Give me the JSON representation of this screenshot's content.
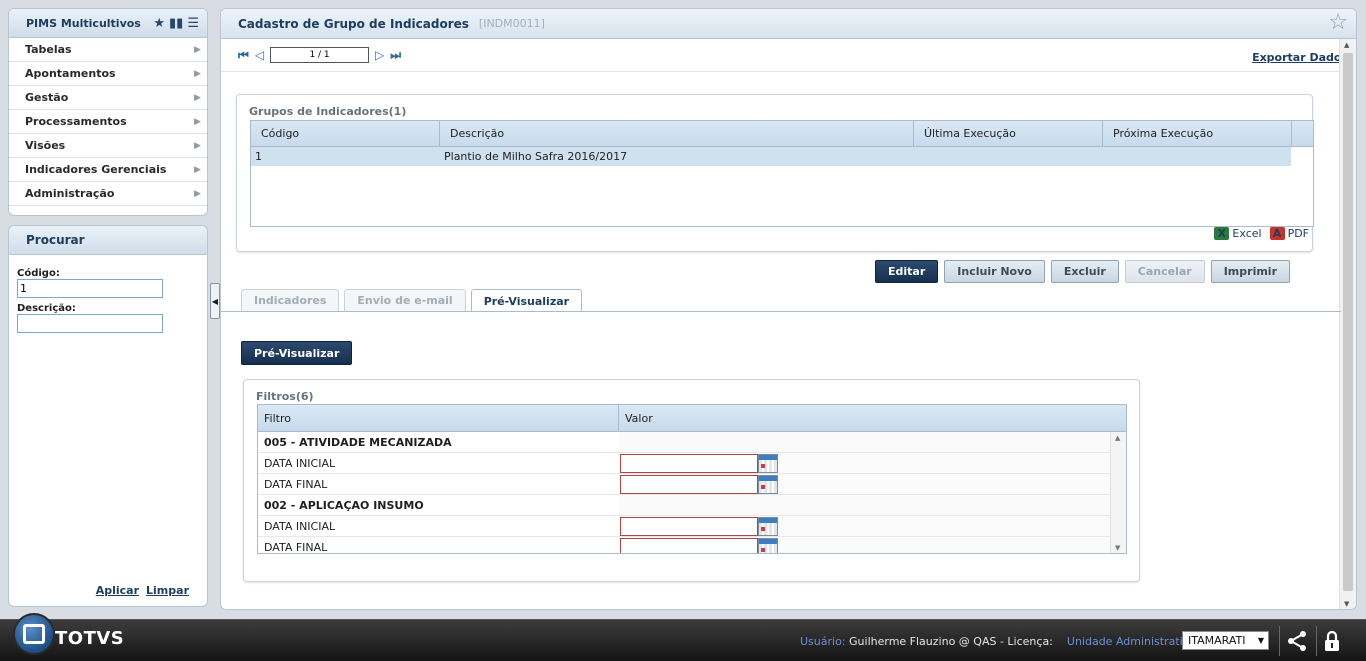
{
  "sidebar": {
    "title": "PIMS Multicultivos",
    "menu": [
      {
        "label": "Tabelas"
      },
      {
        "label": "Apontamentos"
      },
      {
        "label": "Gestão"
      },
      {
        "label": "Processamentos"
      },
      {
        "label": "Visões"
      },
      {
        "label": "Indicadores Gerenciais"
      },
      {
        "label": "Administração"
      }
    ]
  },
  "search": {
    "title": "Procurar",
    "code_label": "Código:",
    "code_value": "1",
    "desc_label": "Descrição:",
    "desc_value": "",
    "apply": "Aplicar",
    "clear": "Limpar"
  },
  "main": {
    "title": "Cadastro de Grupo de Indicadores",
    "code": "[INDM0011]",
    "page_indicator": "1 / 1",
    "export_link": "Exportar Dados"
  },
  "groups": {
    "title": "Grupos de Indicadores(1)",
    "columns": [
      "Código",
      "Descrição",
      "Última Execução",
      "Próxima Execução"
    ],
    "rows": [
      {
        "codigo": "1",
        "descricao": "Plantio de Milho Safra 2016/2017",
        "ultima": "",
        "proxima": ""
      }
    ],
    "excel": "Excel",
    "pdf": "PDF"
  },
  "actions": {
    "edit": "Editar",
    "new": "Incluir Novo",
    "delete": "Excluir",
    "cancel": "Cancelar",
    "print": "Imprimir"
  },
  "tabs": [
    "Indicadores",
    "Envio de e-mail",
    "Pré-Visualizar"
  ],
  "preview_button": "Pré-Visualizar",
  "filters": {
    "title": "Filtros(6)",
    "columns": [
      "Filtro",
      "Valor"
    ],
    "rows": [
      {
        "label": "005 - ATIVIDADE MECANIZADA"
      },
      {
        "label": "DATA INICIAL",
        "value": ""
      },
      {
        "label": "DATA FINAL",
        "value": ""
      },
      {
        "label": "002 - APLICAÇAO INSUMO"
      },
      {
        "label": "DATA INICIAL",
        "value": ""
      },
      {
        "label": "DATA FINAL",
        "value": ""
      }
    ]
  },
  "footer": {
    "brand": "TOTVS",
    "user_label": "Usuário:",
    "user_value": "Guilherme Flauzino @ QAS - Licença:",
    "unit_label": "Unidade Administrativa:",
    "unit_value": "ITAMARATI"
  }
}
